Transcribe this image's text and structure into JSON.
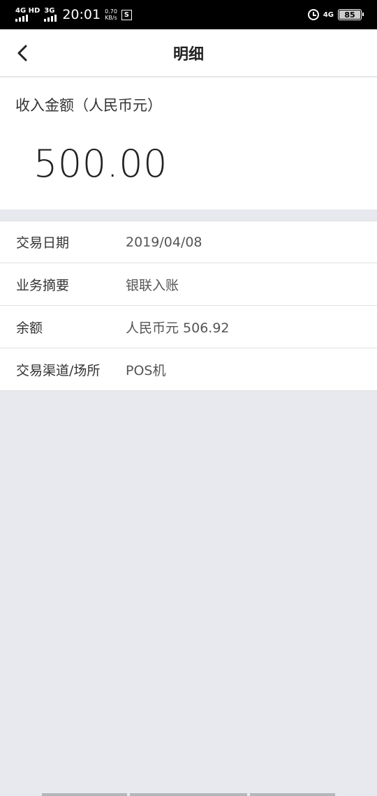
{
  "status_bar": {
    "network_1": "4G HD",
    "network_2": "3G",
    "time": "20:01",
    "speed_value": "0.70",
    "speed_unit": "KB/s",
    "app_icon": "S",
    "network_3": "4G",
    "battery": "85"
  },
  "nav": {
    "title": "明细",
    "back_icon": "chevron-left-icon"
  },
  "amount": {
    "label": "收入金额（人民币元）",
    "value": "500.00"
  },
  "details": [
    {
      "label": "交易日期",
      "value": "2019/04/08"
    },
    {
      "label": "业务摘要",
      "value": "银联入账"
    },
    {
      "label": "余额",
      "value": "人民币元 506.92"
    },
    {
      "label": "交易渠道/场所",
      "value": "POS机"
    }
  ]
}
